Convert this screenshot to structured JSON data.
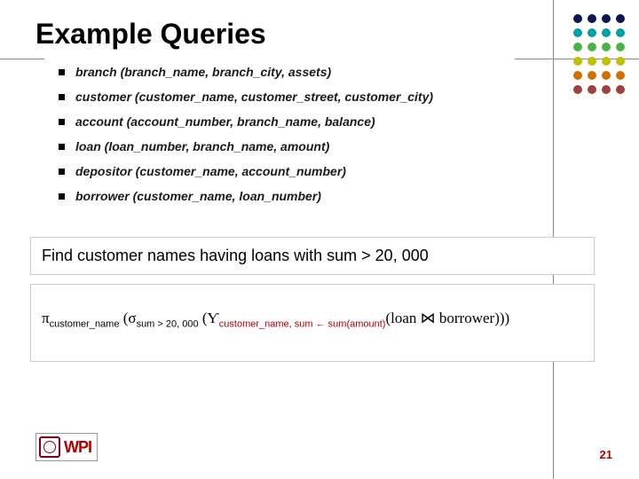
{
  "title": "Example Queries",
  "schema": [
    "branch (branch_name, branch_city, assets)",
    "customer (customer_name, customer_street, customer_city)",
    "account (account_number, branch_name, balance)",
    "loan (loan_number, branch_name, amount)",
    "depositor (customer_name, account_number)",
    "borrower (customer_name, loan_number)"
  ],
  "query_text": "Find customer names having loans with sum > 20, 000",
  "expr": {
    "pi": "π",
    "pi_sub": "customer_name",
    "sigma": "σ",
    "sigma_sub": "sum > 20, 000",
    "gamma": "Ƴ",
    "gamma_sub": "customer_name, sum ← sum(amount)",
    "tail": "(loan ⋈ borrower)))"
  },
  "logo_text": "WPI",
  "page_number": "21"
}
